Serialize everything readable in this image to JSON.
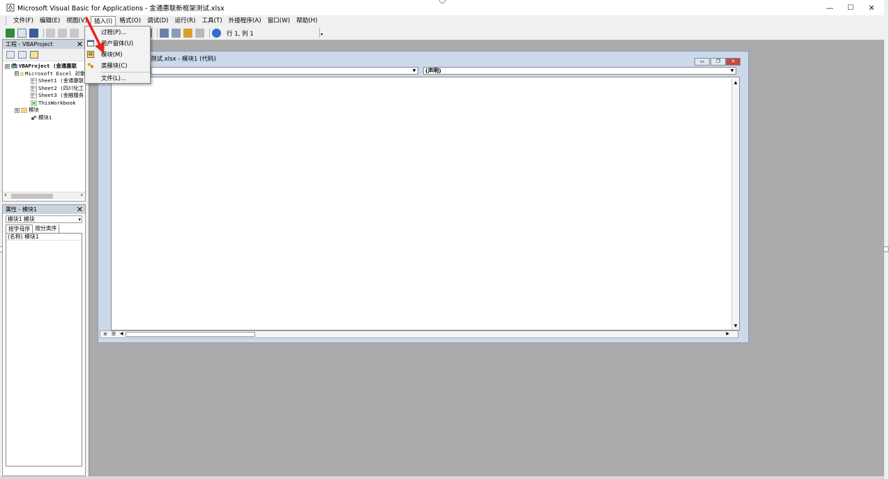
{
  "window": {
    "title": "Microsoft Visual Basic for Applications - 金通惠联新框架测试.xlsx",
    "minimize": "—",
    "maximize": "☐",
    "close": "✕"
  },
  "menubar": {
    "items": [
      "文件(F)",
      "编辑(E)",
      "视图(V)",
      "插入(I)",
      "格式(O)",
      "调试(D)",
      "运行(R)",
      "工具(T)",
      "外接程序(A)",
      "窗口(W)",
      "帮助(H)"
    ]
  },
  "toolbar": {
    "position": "行 1, 列 1",
    "overflow": "▾"
  },
  "insert_menu": {
    "items": [
      "过程(P)...",
      "用户窗体(U)",
      "模块(M)",
      "类模块(C)",
      "文件(L)..."
    ]
  },
  "project_pane": {
    "title": "工程 - VBAProject",
    "close": "✕",
    "tree": [
      {
        "expander": "⊟",
        "text": "VBAProject (金通惠联",
        "bold": true
      },
      {
        "expander": "⊟",
        "text": "Microsoft Excel 对象"
      },
      {
        "expander": "",
        "text": "Sheet1 (金通惠联"
      },
      {
        "expander": "",
        "text": "Sheet2 (四川化工"
      },
      {
        "expander": "",
        "text": "Sheet3 (金融服务"
      },
      {
        "expander": "",
        "text": "ThisWorkbook"
      },
      {
        "expander": "⊟",
        "text": "模块"
      },
      {
        "expander": "",
        "text": "模块1"
      }
    ],
    "scroll_left": "‹",
    "scroll_right": "›"
  },
  "properties_pane": {
    "title": "属性 - 模块1",
    "close": "✕",
    "object_select": "模块1 模块",
    "tabs": [
      "按字母序",
      "按分类序"
    ],
    "rows": [
      "(名称) 模块1"
    ]
  },
  "code_window": {
    "title": "测试.xlsx - 模块1 (代码)",
    "object_combo": "",
    "proc_combo": "(声明)",
    "btn_min": "▭",
    "btn_restore": "❐",
    "btn_close": "✕"
  },
  "colors": {
    "titlebar": "#ffffff",
    "chrome": "#f0f0f0",
    "pane_header": "#c9d3df",
    "mdi_background": "#ababab",
    "code_window_frame": "#cbd9ea",
    "annotation_arrow": "#e8221c"
  }
}
